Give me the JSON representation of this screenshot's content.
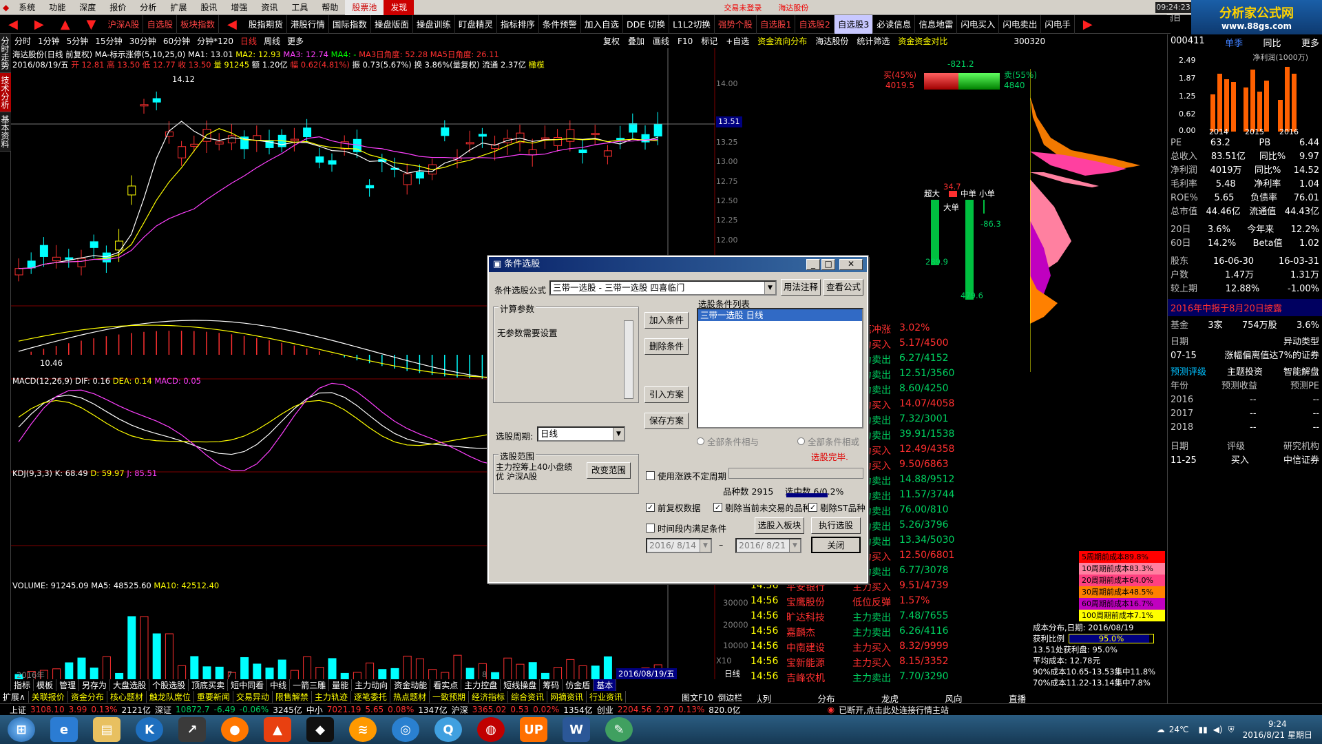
{
  "menubar": {
    "items": [
      "系统",
      "功能",
      "深度",
      "报价",
      "分析",
      "扩展",
      "股讯",
      "增强",
      "资讯",
      "工具",
      "帮助"
    ],
    "special": [
      "股票池",
      "发现"
    ],
    "notice_1": "交易未登录",
    "notice_2": "海达股份",
    "clock": "09:24:23 周日",
    "btn_1": "撤单",
    "btn_2": "自选"
  },
  "logo": {
    "text": "分析家公式网",
    "url": "www.88gs.com"
  },
  "toolbar": {
    "items": [
      "沪深A股",
      "自选股",
      "板块指数",
      "股指期货",
      "港股行情",
      "国际指数",
      "操盘版面",
      "操盘训练",
      "盯盘精灵",
      "指标排序",
      "条件预警",
      "加入自选",
      "DDE 切换",
      "L1L2切换",
      "强势个股",
      "自选股1",
      "自选股2",
      "自选股3",
      "必读信息",
      "信息地雷",
      "闪电买入",
      "闪电卖出",
      "闪电手"
    ]
  },
  "left_tabs": [
    "分时走势",
    "技术分析",
    "基本资料"
  ],
  "periods": [
    "分时",
    "1分钟",
    "5分钟",
    "15分钟",
    "30分钟",
    "60分钟",
    "分钟*120",
    "日线",
    "周线",
    "更多"
  ],
  "chart_tools": [
    "复权",
    "叠加",
    "画线",
    "F10",
    "标记",
    "+自选",
    "资金流向分布",
    "海达股份",
    "统计筛选",
    "资金资金对比"
  ],
  "quote_header": {
    "title": "海达股份(日线 前复权) MA-标示涨停(5,10,25,0)",
    "ma1": "MA1: 13.01",
    "ma2": "MA2: 12.93",
    "ma3": "MA3: 12.74",
    "ma4": "MA4: -",
    "ma3_angle": "MA3日角度: 52.28",
    "ma5_angle": "MA5日角度: 26.11",
    "date_line": "2016/08/19/五",
    "open": "开 12.81",
    "high": "高 13.50",
    "low": "低 12.77",
    "close": "收 13.50",
    "volume": "量 91245",
    "amount": "额 1.20亿",
    "change": "幅 0.62(4.81%)",
    "amplitude": "振 0.73(5.67%)",
    "turnover": "换 3.86%(量复权)",
    "float": "流通 2.37亿",
    "tag": "橄榄",
    "high_mark": "14.12",
    "low_mark": "10.46",
    "current_price_tag": "13.51"
  },
  "price_axis": [
    "14.00",
    "13.50",
    "13.25",
    "13.00",
    "12.75",
    "12.50",
    "12.25",
    "12.00"
  ],
  "macd": {
    "title": "MACD(12,26,9)",
    "dif": "DIF: 0.16",
    "dea": "DEA: 0.14",
    "macd": "MACD: 0.05"
  },
  "kdj": {
    "title": "KDJ(9,3,3)",
    "k": "K: 68.49",
    "d": "D: 59.97",
    "j": "J: 85.51"
  },
  "volume_ind": {
    "title": "VOLUME: 91245.09",
    "ma5": "MA5: 48525.60",
    "ma10": "MA10: 42512.40",
    "axis": [
      "30000",
      "20000",
      "10000"
    ],
    "unit": "X10"
  },
  "x_axis": {
    "start": "2016年",
    "mark1": "7",
    "mark2": "8",
    "current_date": "2016/08/19/五",
    "period": "日线"
  },
  "order_book": {
    "buy_pct": "买(45%)",
    "buy_val": "4019.5",
    "sell_pct": "卖(55%)",
    "sell_val": "4840",
    "diff": "-821.2",
    "super": "超大",
    "super_val": "34.7",
    "big": "大单",
    "mid": "中单",
    "small": "小单",
    "val_289": "289.9",
    "val_479": "479.6",
    "val_863": "-86.3",
    "stock_code": "300320"
  },
  "tick_list": [
    {
      "time": "",
      "name": "",
      "type": "单笔冲涨",
      "value": "3.02%",
      "green": false
    },
    {
      "time": "",
      "name": "",
      "type": "主力买入",
      "value": "5.17/4500",
      "green": false
    },
    {
      "time": "",
      "name": "",
      "type": "主力卖出",
      "value": "6.27/4152",
      "green": true
    },
    {
      "time": "",
      "name": "",
      "type": "主力卖出",
      "value": "12.51/3560",
      "green": true
    },
    {
      "time": "",
      "name": "",
      "type": "主力卖出",
      "value": "8.60/4250",
      "green": true
    },
    {
      "time": "",
      "name": "",
      "type": "主力买入",
      "value": "14.07/4058",
      "green": false
    },
    {
      "time": "",
      "name": "",
      "type": "主力卖出",
      "value": "7.32/3001",
      "green": true
    },
    {
      "time": "",
      "name": "",
      "type": "主力卖出",
      "value": "39.91/1538",
      "green": true
    },
    {
      "time": "",
      "name": "",
      "type": "主力买入",
      "value": "12.49/4358",
      "green": false
    },
    {
      "time": "",
      "name": "",
      "type": "主力买入",
      "value": "9.50/6863",
      "green": false
    },
    {
      "time": "",
      "name": "",
      "type": "主力卖出",
      "value": "14.88/9512",
      "green": true
    },
    {
      "time": "",
      "name": "",
      "type": "主力卖出",
      "value": "11.57/3744",
      "green": true
    },
    {
      "time": "",
      "name": "",
      "type": "主力卖出",
      "value": "76.00/810",
      "green": true
    },
    {
      "time": "",
      "name": "",
      "type": "主力卖出",
      "value": "5.26/3796",
      "green": true
    },
    {
      "time": "",
      "name": "",
      "type": "主力卖出",
      "value": "13.34/5030",
      "green": true
    },
    {
      "time": "",
      "name": "",
      "type": "主力买入",
      "value": "12.50/6801",
      "green": false
    },
    {
      "time": "14:56",
      "name": "陕国投A",
      "type": "主力卖出",
      "value": "6.77/3078",
      "green": true
    },
    {
      "time": "14:56",
      "name": "平安银行",
      "type": "主力买入",
      "value": "9.51/4739",
      "green": false
    },
    {
      "time": "14:56",
      "name": "宝鹰股份",
      "type": "低位反弹",
      "value": "1.57%",
      "green": false
    },
    {
      "time": "14:56",
      "name": "旷达科技",
      "type": "主力卖出",
      "value": "7.48/7655",
      "green": true
    },
    {
      "time": "14:56",
      "name": "嘉麟杰",
      "type": "主力卖出",
      "value": "6.26/4116",
      "green": true
    },
    {
      "time": "14:56",
      "name": "中南建设",
      "type": "主力买入",
      "value": "8.32/9999",
      "green": false
    },
    {
      "time": "14:56",
      "name": "宝新能源",
      "type": "主力买入",
      "value": "8.15/3352",
      "green": false
    },
    {
      "time": "14:56",
      "name": "吉峰农机",
      "type": "主力卖出",
      "value": "7.70/3290",
      "green": true
    }
  ],
  "tick_tabs": [
    "队列",
    "分布",
    "龙虎",
    "风向",
    "直播"
  ],
  "info_panel": {
    "code": "000411",
    "tabs": [
      "单季",
      "同比",
      "更多"
    ],
    "chart_title": "净利润(1000万)",
    "chart_axis": [
      "2.49",
      "1.87",
      "1.25",
      "0.62",
      "0.00"
    ],
    "chart_years": [
      "2014",
      "2015",
      "2016"
    ],
    "rows": [
      {
        "k1": "PE",
        "v1": "63.2",
        "k2": "PB",
        "v2": "6.44"
      },
      {
        "k1": "总收入",
        "v1": "83.51亿",
        "k2": "同比%",
        "v2": "9.97"
      },
      {
        "k1": "净利润",
        "v1": "4019万",
        "k2": "同比%",
        "v2": "14.52"
      },
      {
        "k1": "毛利率",
        "v1": "5.48",
        "k2": "净利率",
        "v2": "1.04"
      },
      {
        "k1": "ROE%",
        "v1": "5.65",
        "k2": "负债率",
        "v2": "76.01"
      },
      {
        "k1": "总市值",
        "v1": "44.46亿",
        "k2": "流通值",
        "v2": "44.43亿"
      }
    ],
    "perf": [
      {
        "k": "20日",
        "v1": "3.6%",
        "k2": "今年来",
        "v2": "12.2%"
      },
      {
        "k": "60日",
        "v1": "14.2%",
        "k2": "Beta值",
        "v2": "1.02"
      }
    ],
    "holders_head": {
      "k": "股东",
      "v1": "16-06-30",
      "v2": "16-03-31"
    },
    "holders": [
      {
        "k": "户数",
        "v1": "1.47万",
        "v2": "1.31万"
      },
      {
        "k": "较上期",
        "v1": "12.88%",
        "v2": "-1.00%"
      }
    ],
    "report_notice": "2016年中报于8月20日披露",
    "fund": {
      "k": "基金",
      "v1": "3家",
      "v2": "754万股",
      "v3": "3.6%"
    },
    "anomaly_head": {
      "k": "日期",
      "v": "异动类型"
    },
    "anomaly": {
      "k": "07-15",
      "v": "涨幅偏离值达7%的证券"
    },
    "fc_tabs": [
      "预测评级",
      "主题投资",
      "智能解盘"
    ],
    "fc_head": {
      "k": "年份",
      "v1": "预测收益",
      "v2": "预测PE"
    },
    "fc_rows": [
      {
        "k": "2016",
        "v1": "--",
        "v2": "--"
      },
      {
        "k": "2017",
        "v1": "--",
        "v2": "--"
      },
      {
        "k": "2018",
        "v1": "--",
        "v2": "--"
      }
    ],
    "rating_head": {
      "k": "日期",
      "v1": "评级",
      "v2": "研究机构"
    },
    "rating": {
      "k": "11-25",
      "v1": "买入",
      "v2": "中信证券"
    }
  },
  "cost_dist": {
    "legend": [
      "5周期前成本89.8%",
      "10周期前成本83.3%",
      "20周期前成本64.0%",
      "30周期前成本48.5%",
      "60周期前成本16.7%",
      "100周期前成本7.1%"
    ],
    "legend_colors": [
      "#ff0000",
      "#ff80a0",
      "#ff4080",
      "#ff8000",
      "#c000c0",
      "#ffff00"
    ],
    "date": "成本分布,日期: 2016/08/19",
    "profit_ratio_label": "获利比例",
    "profit_ratio": "95.0%",
    "profit_pct": 95.0,
    "line1": "13.51处获利盘: 95.0%",
    "line2": "平均成本: 12.78元",
    "line3": "90%成本10.65-13.53集中11.8%",
    "line4": "70%成本11.22-13.14集中7.8%"
  },
  "dialog": {
    "title": "条件选股",
    "formula_label": "条件选股公式",
    "formula_value": "三带一选股  - 三带一选股 四喜临门",
    "btn_usage": "用法注释",
    "btn_view": "查看公式",
    "params_group": "计算参数",
    "params_text": "无参数需要设置",
    "btn_add": "加入条件",
    "btn_delete": "删除条件",
    "btn_import": "引入方案",
    "btn_save": "保存方案",
    "list_label": "选股条件列表",
    "list_item": "三带一选股  日线",
    "period_label": "选股周期:",
    "period_value": "日线",
    "radio_and": "全部条件相与",
    "radio_or": "全部条件相或",
    "done_text": "选股完毕.",
    "scope_group": "选股范围",
    "scope_text": "主力控筹上40小盘绩优 沪深A股",
    "btn_scope": "改变范围",
    "use_rise": "使用涨跌不定周期",
    "count_label": "品种数 2915",
    "selected_label": "选中数 6/0.2%",
    "chk_adjust": "前复权数据",
    "chk_exclude": "剔除当前未交易的品种",
    "chk_st": "剔除ST品种",
    "chk_time": "时间段内满足条件",
    "btn_to_block": "选股入板块",
    "btn_run": "执行选股",
    "date_from": "2016/ 8/14",
    "date_to": "2016/ 8/21",
    "btn_close": "关闭"
  },
  "bottom_tabs_1": [
    "指标",
    "模板",
    "管理",
    "另存为",
    "大盘选股",
    "个股选股",
    "顶底买卖",
    "短中同看",
    "中线",
    "一箭三雕",
    "量能",
    "主力动向",
    "资金动能",
    "看实点",
    "主力控盘",
    "短线操盘",
    "筹码",
    "仿金盾",
    "基本"
  ],
  "bottom_tabs_2": [
    "扩展∧",
    "关联报价",
    "资金分布",
    "核心题材",
    "触龙队席位",
    "重要新闻",
    "交易异动",
    "限售解禁",
    "主力轨迹",
    "逐笔委托",
    "热点题材",
    "一致预期",
    "经济指标",
    "综合资讯",
    "网摘资讯",
    "行业资讯"
  ],
  "chart_mode": [
    "图文F10",
    "倒边栏"
  ],
  "statusbar": {
    "sh_label": "上证",
    "sh_val": "3108.10",
    "sh_chg": "3.99",
    "sh_pct": "0.13%",
    "sh_amt": "2121亿",
    "sz_label": "深证",
    "sz_val": "10872.7",
    "sz_chg": "-6.49",
    "sz_pct": "-0.06%",
    "sz_amt": "3245亿",
    "zx_label": "中小",
    "zx_val": "7021.19",
    "zx_chg": "5.65",
    "zx_pct": "0.08%",
    "zx_amt": "1347亿",
    "hs_label": "沪深",
    "hs_val": "3365.02",
    "hs_chg": "0.53",
    "hs_pct": "0.02%",
    "hs_amt": "1354亿",
    "cy_label": "创业",
    "cy_val": "2204.56",
    "cy_chg": "2.97",
    "cy_pct": "0.13%",
    "cy_amt": "820.0亿",
    "message": "已断开,点击此处连接行情主站"
  },
  "taskbar": {
    "temp": "24℃",
    "time": "9:24",
    "date": "2016/8/21 星期日"
  }
}
